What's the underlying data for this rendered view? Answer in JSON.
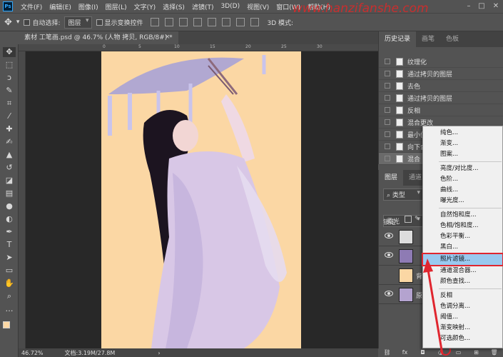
{
  "menubar": {
    "items": [
      "文件(F)",
      "编辑(E)",
      "图像(I)",
      "图层(L)",
      "文字(Y)",
      "选择(S)",
      "滤镜(T)",
      "3D(D)",
      "视图(V)",
      "窗口(W)",
      "帮助(H)"
    ],
    "logo": "Ps"
  },
  "options": {
    "auto_select_label": "自动选择:",
    "auto_select_value": "图层",
    "show_transform_label": "显示变换控件",
    "mode3d_label": "3D 模式:"
  },
  "document": {
    "tab_title": "素材 工笔画.psd @ 46.7% (人物 拷贝, RGB/8#) *",
    "close_glyph": "×"
  },
  "ruler_ticks": [
    "0",
    "5",
    "10",
    "15",
    "20",
    "25",
    "30"
  ],
  "status": {
    "zoom": "46.72%",
    "doc_size": "文档:3.19M/27.8M"
  },
  "history": {
    "tabs": [
      "历史记录",
      "画笔",
      "色板"
    ],
    "items": [
      "纹理化",
      "通过拷贝的图层",
      "去色",
      "通过拷贝的图层",
      "反相",
      "混合更改",
      "最小值",
      "向下合",
      "混合"
    ]
  },
  "layers": {
    "tabs": [
      "图层",
      "通道"
    ],
    "filter_value": "类型",
    "blend_mode": "柔光",
    "lock_label": "锁定:",
    "rows": [
      {
        "name": ""
      },
      {
        "name": ""
      },
      {
        "name": "背"
      },
      {
        "name": "原"
      }
    ]
  },
  "adjustment_menu": {
    "items": [
      "纯色...",
      "渐变...",
      "图案...",
      "亮度/对比度...",
      "色阶...",
      "曲线...",
      "曝光度...",
      "自然饱和度...",
      "色相/饱和度...",
      "色彩平衡...",
      "黑白...",
      "照片滤镜...",
      "通道混合器...",
      "颜色查找...",
      "反相",
      "色调分离...",
      "阈值...",
      "渐变映射...",
      "可选颜色..."
    ],
    "highlighted": "照片滤镜..."
  },
  "watermark": "www.hanzifanshe.com",
  "colors": {
    "canvas_bg": "#fbd7a4",
    "highlight_outline": "#e0262f",
    "menu_highlight": "#99c9ef"
  }
}
